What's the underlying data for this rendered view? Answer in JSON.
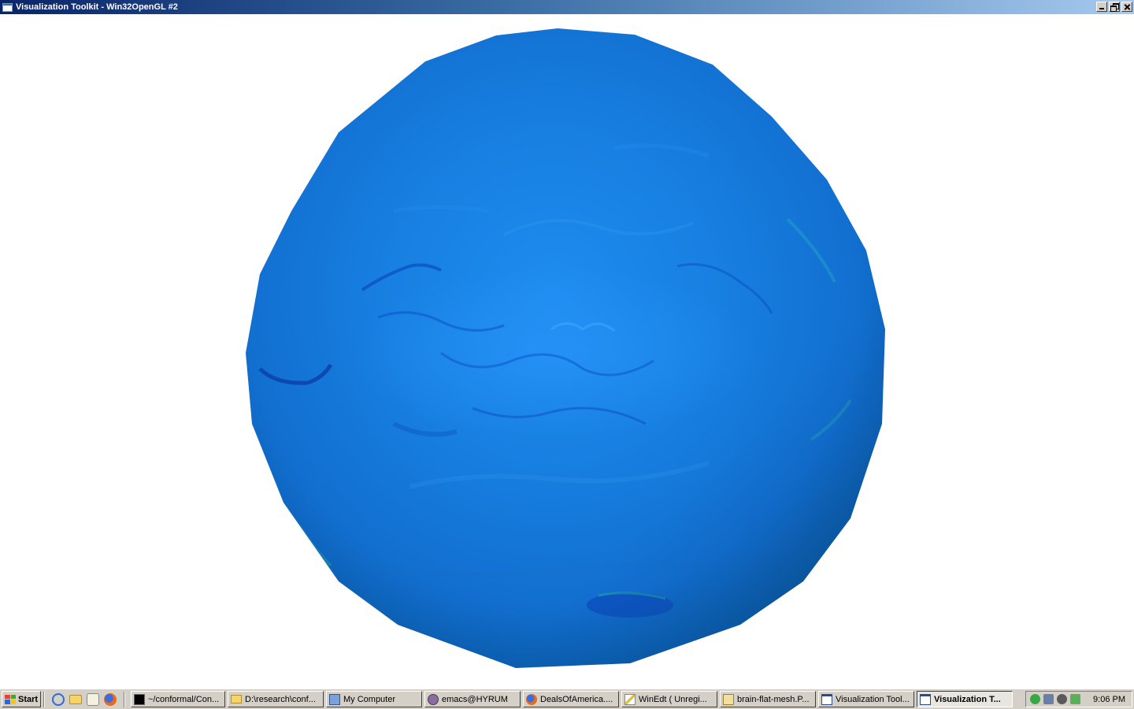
{
  "window": {
    "title": "Visualization Toolkit - Win32OpenGL #2"
  },
  "scene": {
    "object": "sphere",
    "colors": {
      "highlight": "#1e8cf0",
      "mid": "#126fd0",
      "shadow": "#0a4f9c",
      "rim": "#074a7a",
      "background": "#ffffff"
    }
  },
  "taskbar": {
    "start_label": "Start",
    "quick_launch": [
      "ie-icon",
      "folder-icon",
      "notepad-icon",
      "firefox-icon"
    ],
    "tasks": [
      {
        "label": "~/conformal/Con...",
        "icon": "terminal-icon",
        "active": false
      },
      {
        "label": "D:\\research\\conf...",
        "icon": "folder-icon",
        "active": false
      },
      {
        "label": "My Computer",
        "icon": "computer-icon",
        "active": false
      },
      {
        "label": "emacs@HYRUM",
        "icon": "emacs-icon",
        "active": false
      },
      {
        "label": "DealsOfAmerica....",
        "icon": "firefox-icon",
        "active": false
      },
      {
        "label": "WinEdt  ( Unregi...",
        "icon": "pen-icon",
        "active": false
      },
      {
        "label": "brain-flat-mesh.P...",
        "icon": "document-icon",
        "active": false
      },
      {
        "label": "Visualization Tool...",
        "icon": "vtk-window-icon",
        "active": false
      },
      {
        "label": "Visualization T...",
        "icon": "vtk-window-icon",
        "active": true
      }
    ],
    "clock": "9:06 PM"
  }
}
